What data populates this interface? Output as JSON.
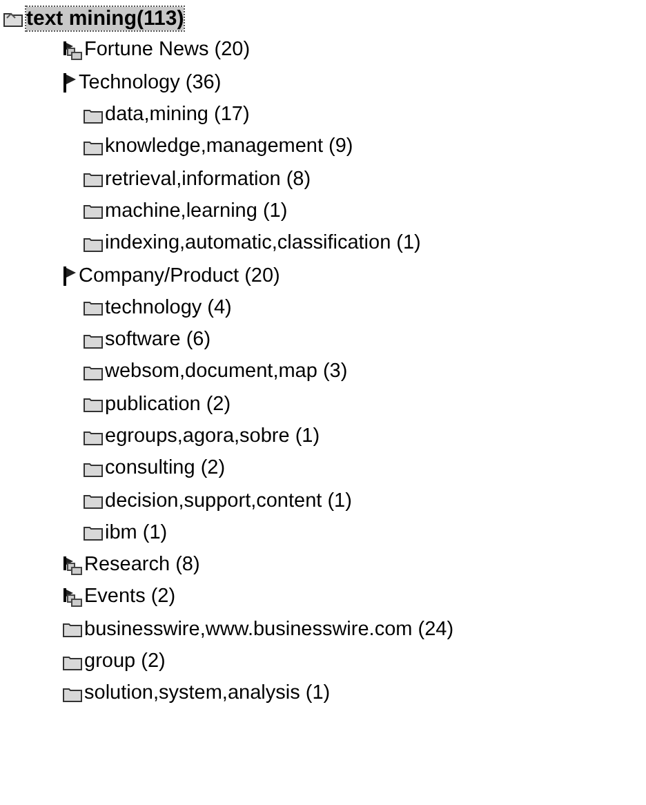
{
  "tree": {
    "label": "text mining(113)",
    "selected": true,
    "children": [
      {
        "label": "Fortune News (20)",
        "kind": "category",
        "expanded": false
      },
      {
        "label": "Technology (36)",
        "kind": "category",
        "expanded": true,
        "children": [
          {
            "label": "data,mining (17)",
            "kind": "folder"
          },
          {
            "label": "knowledge,management (9)",
            "kind": "folder"
          },
          {
            "label": "retrieval,information (8)",
            "kind": "folder"
          },
          {
            "label": "machine,learning (1)",
            "kind": "folder"
          },
          {
            "label": "indexing,automatic,classification (1)",
            "kind": "folder"
          }
        ]
      },
      {
        "label": "Company/Product (20)",
        "kind": "category",
        "expanded": true,
        "children": [
          {
            "label": "technology (4)",
            "kind": "folder"
          },
          {
            "label": "software (6)",
            "kind": "folder"
          },
          {
            "label": "websom,document,map (3)",
            "kind": "folder"
          },
          {
            "label": "publication (2)",
            "kind": "folder"
          },
          {
            "label": "egroups,agora,sobre (1)",
            "kind": "folder"
          },
          {
            "label": "consulting (2)",
            "kind": "folder"
          },
          {
            "label": "decision,support,content (1)",
            "kind": "folder"
          },
          {
            "label": "ibm (1)",
            "kind": "folder"
          }
        ]
      },
      {
        "label": "Research (8)",
        "kind": "category",
        "expanded": false
      },
      {
        "label": "Events (2)",
        "kind": "category",
        "expanded": false
      },
      {
        "label": "businesswire,www.businesswire.com (24)",
        "kind": "folder"
      },
      {
        "label": "group (2)",
        "kind": "folder"
      },
      {
        "label": "solution,system,analysis (1)",
        "kind": "folder"
      }
    ]
  }
}
